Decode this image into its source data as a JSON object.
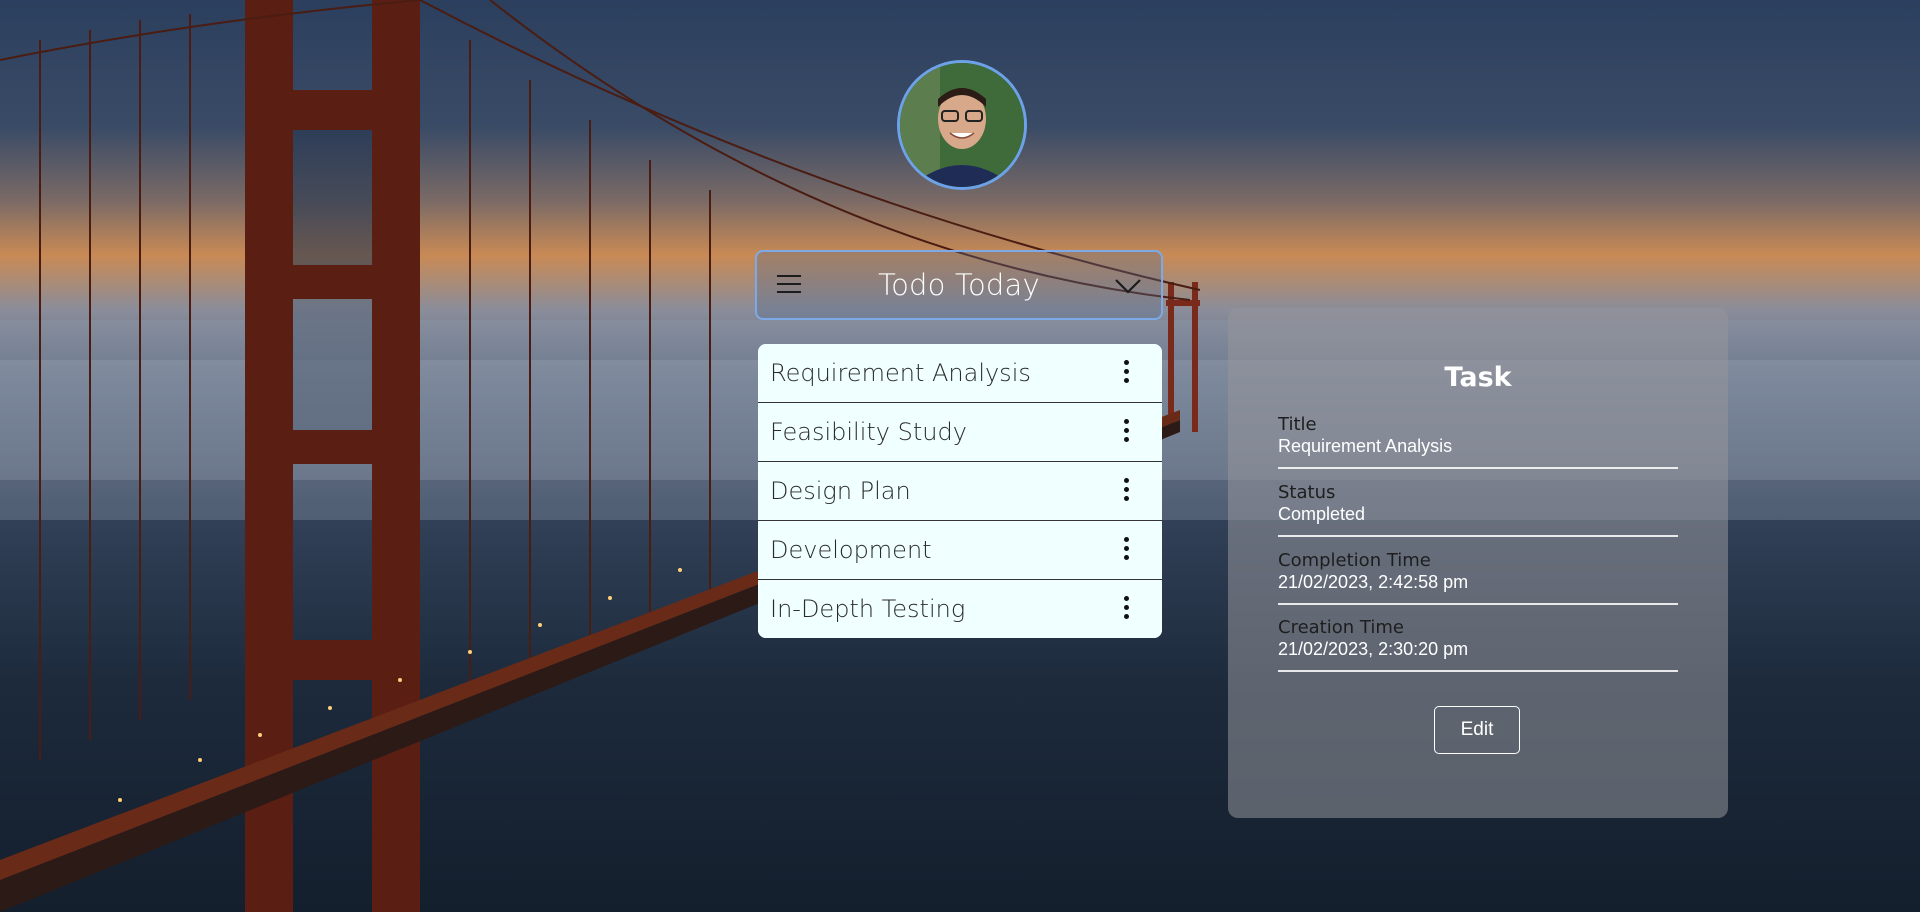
{
  "list": {
    "title": "Todo Today",
    "items": [
      {
        "label": "Requirement Analysis"
      },
      {
        "label": "Feasibility Study"
      },
      {
        "label": "Design Plan"
      },
      {
        "label": "Development"
      },
      {
        "label": "In-Depth Testing"
      }
    ]
  },
  "task_panel": {
    "heading": "Task",
    "fields": [
      {
        "label": "Title",
        "value": "Requirement Analysis"
      },
      {
        "label": "Status",
        "value": "Completed"
      },
      {
        "label": "Completion Time",
        "value": "21/02/2023, 2:42:58 pm"
      },
      {
        "label": "Creation Time",
        "value": "21/02/2023, 2:30:20 pm"
      }
    ],
    "edit_label": "Edit"
  },
  "icons": {
    "menu": "hamburger-icon",
    "expand": "chevron-down-icon",
    "item_menu": "more-vertical-icon"
  },
  "colors": {
    "list_background": "#f0ffff",
    "header_border": "#7ea9e8",
    "avatar_border": "#6ea2e8"
  }
}
